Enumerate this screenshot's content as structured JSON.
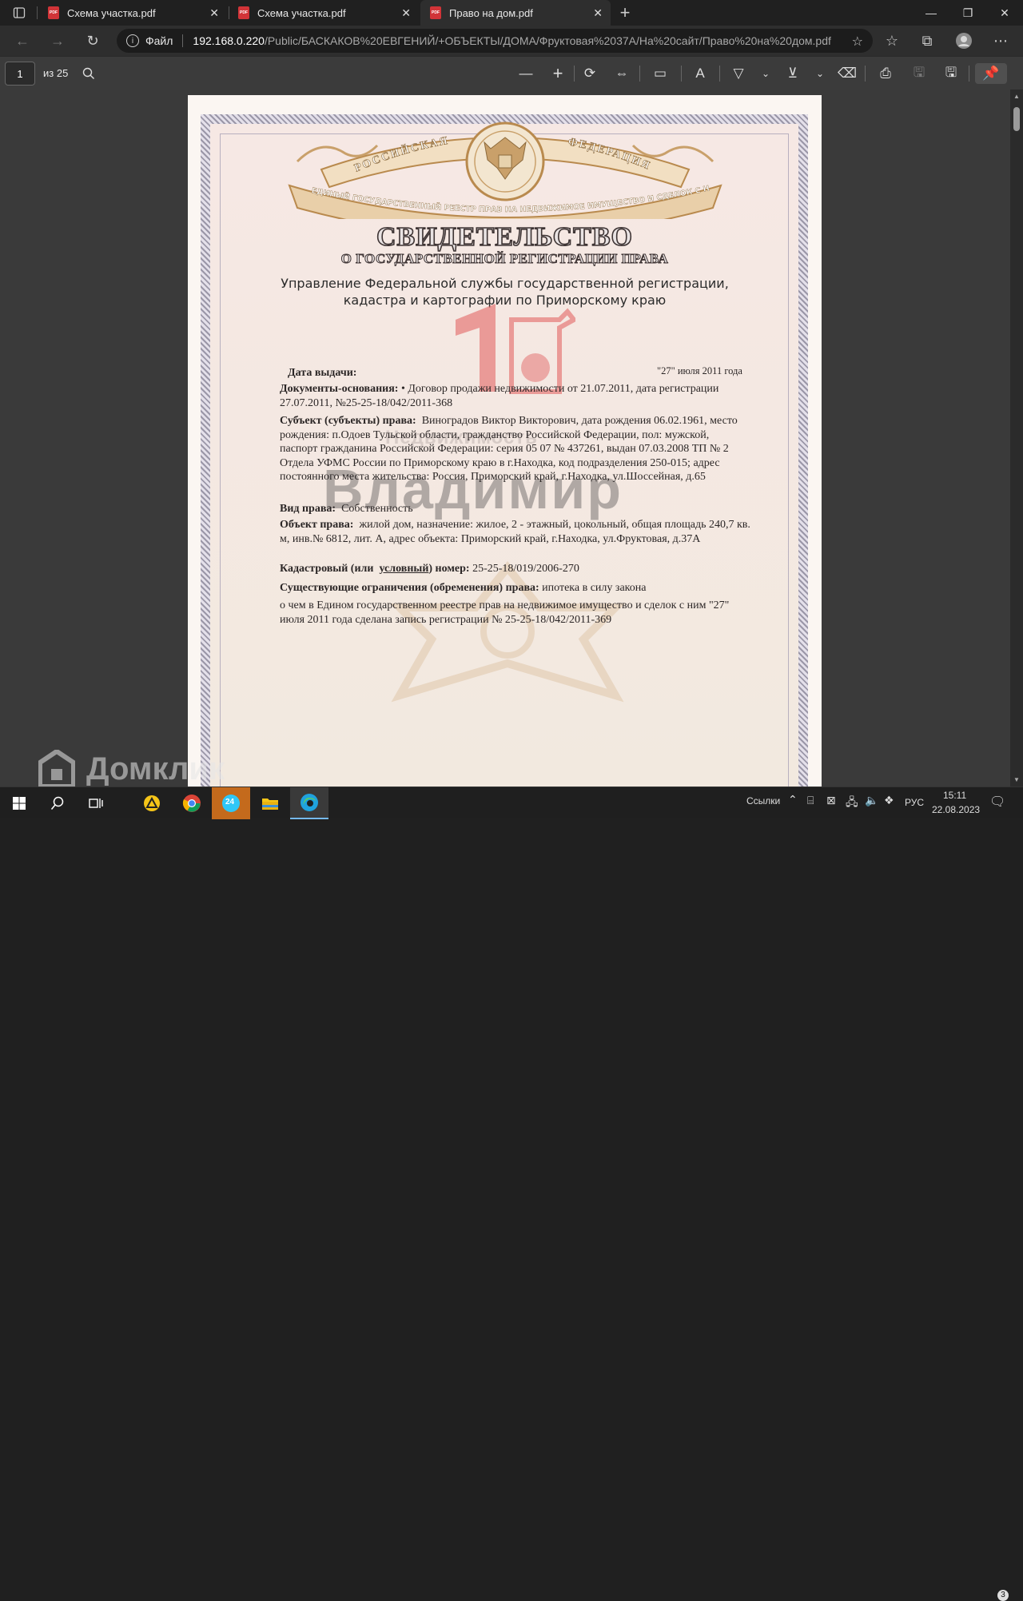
{
  "browser": {
    "tabs": [
      {
        "title": "Схема участка.pdf",
        "active": false
      },
      {
        "title": "Схема участка.pdf",
        "active": false
      },
      {
        "title": "Право на дом.pdf",
        "active": true
      }
    ],
    "new_tab_label": "+",
    "url": {
      "scheme_label": "Файл",
      "host": "192.168.0.220",
      "path": "/Public/БАСКАКОВ%20ЕВГЕНИЙ/+ОБЪЕКТЫ/ДОМА/Фруктовая%2037А/На%20сайт/Право%20на%20дом.pdf"
    }
  },
  "pdf_toolbar": {
    "page_current": "1",
    "page_total": "из 25"
  },
  "document": {
    "emblem_top_left": "РОССИЙСКАЯ",
    "emblem_top_right": "ФЕДЕРАЦИЯ",
    "emblem_ribbon": "ЕДИНЫЙ ГОСУДАРСТВЕННЫЙ РЕЕСТР ПРАВ НА НЕДВИЖИМОЕ ИМУЩЕСТВО И СДЕЛОК С НИМ",
    "title": "СВИДЕТЕЛЬСТВО",
    "subtitle": "О ГОСУДАРСТВЕННОЙ РЕГИСТРАЦИИ ПРАВА",
    "agency_line1": "Управление Федеральной службы государственной регистрации,",
    "agency_line2": "кадастра и картографии по Приморскому краю",
    "issue_label": "Дата выдачи:",
    "issue_date": "\"27\" июля 2011 года",
    "docs_label": "Документы-основания:",
    "docs_line1": "• Договор продажи недвижимости от 21.07.2011, дата регистрации",
    "docs_line2": "27.07.2011, №25-25-18/042/2011-368",
    "subject_label": "Субъект (субъекты) права:",
    "subject_line1": "Виноградов Виктор Викторович, дата рождения 06.02.1961, место",
    "subject_line2": "рождения: п.Одоев Тульской области, гражданство Российской Федерации, пол: мужской,",
    "subject_line3": "паспорт гражданина Российской Федерации: серия 05 07 № 437261, выдан 07.03.2008 ТП № 2",
    "subject_line4": "Отдела УФМС России по Приморскому краю в г.Находка, код подразделения 250-015; адрес",
    "subject_line5": "постоянного места жительства: Россия, Приморский край, г.Находка, ул.Шоссейная, д.65",
    "right_label": "Вид права:",
    "right_value": "Собственность",
    "object_label": "Объект права:",
    "object_line1": "жилой дом, назначение: жилое, 2 - этажный, цокольный, общая площадь 240,7 кв.",
    "object_line2": "м, инв.№ 6812, лит. А, адрес объекта: Приморский край, г.Находка, ул.Фруктовая, д.37А",
    "cadastral_label_a": "Кадастровый (или",
    "cadastral_label_b": "условный",
    "cadastral_label_c": ") номер:",
    "cadastral_value": "25-25-18/019/2006-270",
    "restrict_label": "Существующие ограничения (обременения) права:",
    "restrict_value": "ипотека в силу закона",
    "record_line1": "о чем в Едином государственном реестре прав на недвижимое имущество и сделок с ним \"27\"",
    "record_line2": "июля 2011 года сделана запись регистрации № 25-25-18/042/2011-369",
    "watermark_city_small": "Недвижимость",
    "watermark_city": "Владимир"
  },
  "overlay": {
    "brand": "Домклик"
  },
  "taskbar": {
    "links_label": "Ссылки",
    "language": "РУС",
    "time": "15:11",
    "date": "22.08.2023",
    "notifications": "3",
    "app_badge": "24"
  },
  "colors": {
    "accent": "#76b9ed",
    "pdf_icon": "#d13438",
    "emblem_gold": "#b98a4e",
    "watermark_red": "#e05a5a"
  }
}
